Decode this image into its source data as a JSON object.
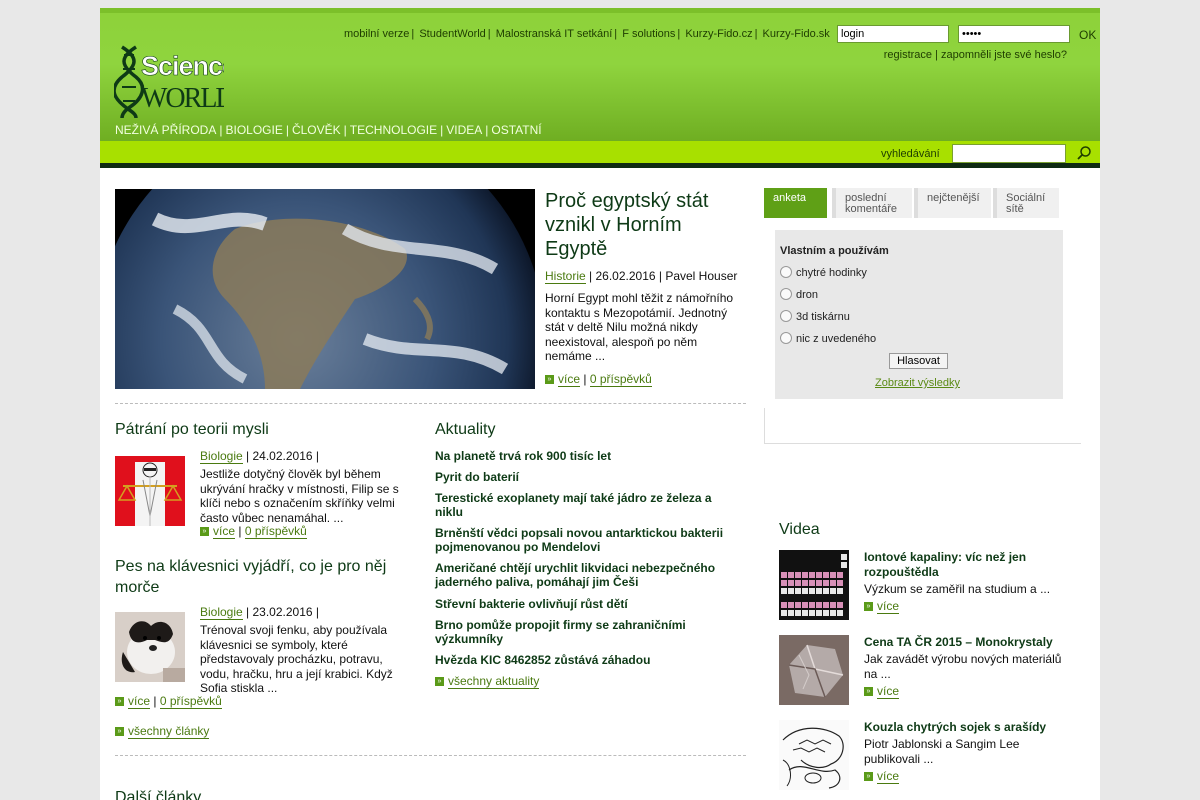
{
  "header": {
    "toplinks": [
      "mobilní verze",
      "StudentWorld",
      "Malostranská IT setkání",
      "F solutions",
      "Kurzy-Fido.cz",
      "Kurzy-Fido.sk"
    ],
    "login_value": "login",
    "password_value": "•••••",
    "ok_label": "OK",
    "register_label": "registrace",
    "forgot_label": "zapomněli jste své heslo?",
    "logo_line1": "Science",
    "logo_line2": "WORLD",
    "categories": [
      "NEŽIVÁ PŘÍRODA",
      "BIOLOGIE",
      "ČLOVĚK",
      "TECHNOLOGIE",
      "VIDEA",
      "OSTATNÍ"
    ],
    "search_label": "vyhledávání",
    "search_value": ""
  },
  "hero": {
    "title": "Proč egyptský stát vznikl v Horním Egyptě",
    "category": "Historie",
    "meta": "| 26.02.2016 | Pavel Houser",
    "text": "Horní Egypt mohl těžit z námořního kontaktu s Mezopotámií. Jednotný stát v deltě Nilu možná nikdy neexistoval, alespoň po něm nemáme ...",
    "more": "více",
    "comments": "0 příspěvků"
  },
  "articles": [
    {
      "title": "Pátrání po teorii mysli",
      "category": "Biologie",
      "meta": "| 24.02.2016 |",
      "text": "Jestliže dotyčný člověk byl během ukrývání hračky v místnosti, Filip se s klíči nebo s označením skříňky velmi často vůbec nenamáhal. ...",
      "more": "více",
      "comments": "0 příspěvků"
    },
    {
      "title": "Pes na klávesnici vyjádří, co je pro něj morče",
      "category": "Biologie",
      "meta": "| 23.02.2016 |",
      "text": "Trénoval svoji fenku, aby používala klávesnici se symboly, které představovaly procházku, potravu, vodu, hračku, hru a její krabici. Když Sofia stiskla ...",
      "more": "více",
      "comments": "0 příspěvků"
    }
  ],
  "all_articles": "všechny články",
  "more_articles_title": "Další články",
  "news": {
    "title": "Aktuality",
    "items": [
      "Na planetě trvá rok 900 tisíc let",
      "Pyrit do baterií",
      "Terestické exoplanety mají také jádro ze železa a niklu",
      "Brněnští vědci popsali novou antarktickou bakterii pojmenovanou po Mendelovi",
      "Američané chtějí urychlit likvidaci nebezpečného jaderného paliva, pomáhají jim Češi",
      "Střevní bakterie ovlivňují růst dětí",
      "Brno pomůže propojit firmy se zahraničními výzkumníky",
      "Hvězda KIC 8462852 zůstává záhadou"
    ],
    "all": "všechny aktuality"
  },
  "sidebar": {
    "tabs": [
      "anketa",
      "poslední komentáře",
      "nejčtenější",
      "Sociální sítě"
    ],
    "poll": {
      "question": "Vlastním a používám",
      "options": [
        "chytré hodinky",
        "dron",
        "3d tiskárnu",
        "nic z uvedeného"
      ],
      "vote": "Hlasovat",
      "results": "Zobrazit výsledky"
    },
    "video_title": "Videa",
    "videos": [
      {
        "title": "Iontové kapaliny: víc než jen rozpouštědla",
        "text": "Výzkum se zaměřil na studium a ...",
        "more": "více"
      },
      {
        "title": "Cena TA ČR 2015 – Monokrystaly",
        "text": "Jak zavádět výrobu nových materiálů na ...",
        "more": "více"
      },
      {
        "title": "Kouzla chytrých sojek s arašídy",
        "text": "Piotr Jablonski a Sangim Lee publikovali ...",
        "more": "více"
      }
    ]
  },
  "colors": {
    "header_green": "#8ed23a",
    "search_bar": "#a8e000",
    "dark_green": "#0e3a16",
    "link_green": "#4a7a10",
    "tab_active": "#5fa016"
  }
}
